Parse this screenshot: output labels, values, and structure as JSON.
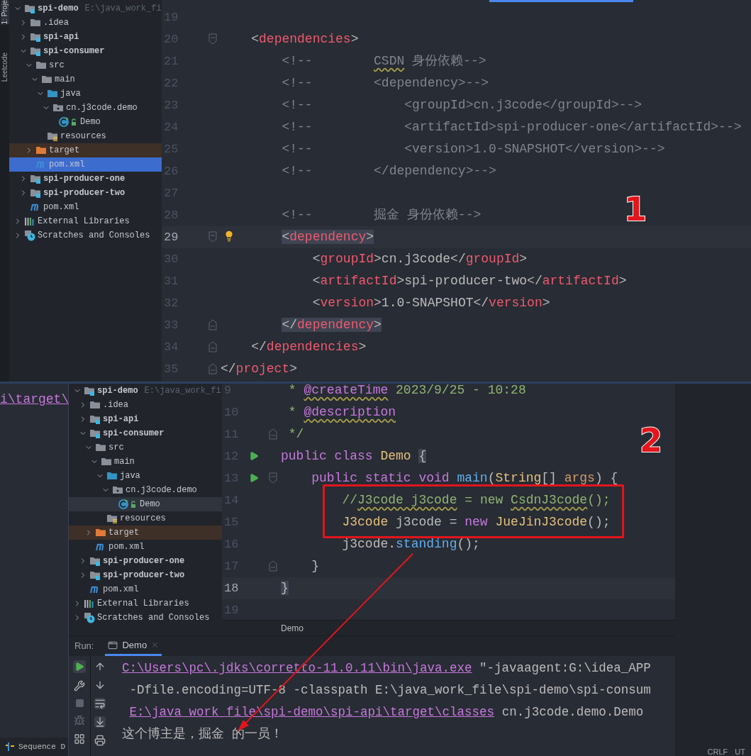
{
  "top": {
    "side_tabs": [
      "1: Proje",
      "Leetcode"
    ],
    "tree": {
      "focused": true,
      "items": [
        {
          "label": "spi-demo",
          "kind": "module",
          "path": "E:\\java_work_fi",
          "expanded": true,
          "selected": false,
          "children": [
            {
              "label": ".idea",
              "kind": "folder",
              "expanded": false,
              "selected": false
            },
            {
              "label": "spi-api",
              "kind": "module",
              "expanded": false,
              "selected": false
            },
            {
              "label": "spi-consumer",
              "kind": "module",
              "expanded": true,
              "selected": false,
              "children": [
                {
                  "label": "src",
                  "kind": "folder",
                  "expanded": true,
                  "selected": false,
                  "children": [
                    {
                      "label": "main",
                      "kind": "folder",
                      "expanded": true,
                      "selected": false,
                      "children": [
                        {
                          "label": "java",
                          "kind": "source",
                          "expanded": true,
                          "selected": false,
                          "children": [
                            {
                              "label": "cn.j3code.demo",
                              "kind": "package",
                              "expanded": true,
                              "selected": false,
                              "children": [
                                {
                                  "label": "Demo",
                                  "kind": "class",
                                  "selected": false
                                }
                              ]
                            }
                          ]
                        },
                        {
                          "label": "resources",
                          "kind": "resources",
                          "selected": false
                        }
                      ]
                    }
                  ]
                },
                {
                  "label": "target",
                  "kind": "excluded",
                  "expanded": false,
                  "selected": false
                },
                {
                  "label": "pom.xml",
                  "kind": "maven",
                  "selected": true
                }
              ]
            },
            {
              "label": "spi-producer-one",
              "kind": "module",
              "expanded": false,
              "selected": false
            },
            {
              "label": "spi-producer-two",
              "kind": "module",
              "expanded": false,
              "selected": false
            },
            {
              "label": "pom.xml",
              "kind": "maven",
              "selected": false
            }
          ]
        },
        {
          "label": "External Libraries",
          "kind": "libraries",
          "expanded": false,
          "selected": false
        },
        {
          "label": "Scratches and Consoles",
          "kind": "scratches",
          "expanded": false,
          "selected": false
        }
      ]
    },
    "editor": {
      "lines": [
        {
          "number": "19",
          "current": false
        },
        {
          "number": "20",
          "current": false,
          "fold_start": true,
          "tokens": [
            {
              "t": "    <",
              "kind": "punct"
            },
            {
              "t": "dependencies",
              "kind": "tag"
            },
            {
              "t": ">",
              "kind": "punct"
            }
          ]
        },
        {
          "number": "21",
          "current": false,
          "tokens": [
            {
              "t": "        <!--        ",
              "kind": "comment"
            },
            {
              "t": "CSDN",
              "kind": "comment",
              "typo": true
            },
            {
              "t": " 身份依赖-->",
              "kind": "comment"
            }
          ]
        },
        {
          "number": "22",
          "current": false,
          "tokens": [
            {
              "t": "        <!--        <dependency>-->",
              "kind": "comment"
            }
          ]
        },
        {
          "number": "23",
          "current": false,
          "tokens": [
            {
              "t": "        <!--            <groupId>cn.j3code</groupId>-->",
              "kind": "comment"
            }
          ]
        },
        {
          "number": "24",
          "current": false,
          "tokens": [
            {
              "t": "        <!--            <artifactId>spi-producer-one</artifactId>-->",
              "kind": "comment"
            }
          ]
        },
        {
          "number": "25",
          "current": false,
          "tokens": [
            {
              "t": "        <!--            <version>1.0-SNAPSHOT</version>-->",
              "kind": "comment"
            }
          ]
        },
        {
          "number": "26",
          "current": false,
          "tokens": [
            {
              "t": "        <!--        </dependency>-->",
              "kind": "comment"
            }
          ]
        },
        {
          "number": "27",
          "current": false
        },
        {
          "number": "28",
          "current": false,
          "tokens": [
            {
              "t": "        <!--        掘金 身份依赖-->",
              "kind": "comment"
            }
          ]
        },
        {
          "number": "29",
          "current": true,
          "fold_start": true,
          "bulb": true,
          "tokens": [
            {
              "t": "        <",
              "kind": "punct",
              "match": true
            },
            {
              "t": "dependency",
              "kind": "tag",
              "match": true
            },
            {
              "t": ">",
              "kind": "punct",
              "match": true
            }
          ]
        },
        {
          "number": "30",
          "current": false,
          "tokens": [
            {
              "t": "            <",
              "kind": "punct"
            },
            {
              "t": "groupId",
              "kind": "tag"
            },
            {
              "t": ">cn.j3code</",
              "kind": "punct"
            },
            {
              "t": "groupId",
              "kind": "tag"
            },
            {
              "t": ">",
              "kind": "punct"
            }
          ]
        },
        {
          "number": "31",
          "current": false,
          "tokens": [
            {
              "t": "            <",
              "kind": "punct"
            },
            {
              "t": "artifactId",
              "kind": "tag"
            },
            {
              "t": ">spi-producer-two</",
              "kind": "punct"
            },
            {
              "t": "artifactId",
              "kind": "tag"
            },
            {
              "t": ">",
              "kind": "punct"
            }
          ]
        },
        {
          "number": "32",
          "current": false,
          "tokens": [
            {
              "t": "            <",
              "kind": "punct"
            },
            {
              "t": "version",
              "kind": "tag"
            },
            {
              "t": ">1.0-SNAPSHOT</",
              "kind": "punct"
            },
            {
              "t": "version",
              "kind": "tag"
            },
            {
              "t": ">",
              "kind": "punct"
            }
          ]
        },
        {
          "number": "33",
          "current": false,
          "fold_end": true,
          "tokens": [
            {
              "t": "        </",
              "kind": "punct",
              "match": true
            },
            {
              "t": "dependency",
              "kind": "tag",
              "match": true
            },
            {
              "t": ">",
              "kind": "punct",
              "match": true
            }
          ]
        },
        {
          "number": "34",
          "current": false,
          "fold_end": true,
          "tokens": [
            {
              "t": "    </",
              "kind": "punct"
            },
            {
              "t": "dependencies",
              "kind": "tag"
            },
            {
              "t": ">",
              "kind": "punct"
            }
          ]
        },
        {
          "number": "35",
          "current": false,
          "fold_end": true,
          "tokens": [
            {
              "t": "</",
              "kind": "punct"
            },
            {
              "t": "project",
              "kind": "tag"
            },
            {
              "t": ">",
              "kind": "punct"
            }
          ]
        }
      ]
    },
    "annotations": [
      {
        "kind": "number",
        "text": "1"
      }
    ]
  },
  "bottom": {
    "left_link": "i\\target\\",
    "left_tool": "Sequence D",
    "tree": {
      "focused": false,
      "items": [
        {
          "label": "spi-demo",
          "kind": "module",
          "path": "E:\\java_work_fi",
          "expanded": true,
          "selected": false,
          "children": [
            {
              "label": ".idea",
              "kind": "folder",
              "expanded": false,
              "selected": false
            },
            {
              "label": "spi-api",
              "kind": "module",
              "expanded": false,
              "selected": false
            },
            {
              "label": "spi-consumer",
              "kind": "module",
              "expanded": true,
              "selected": false,
              "children": [
                {
                  "label": "src",
                  "kind": "folder",
                  "expanded": true,
                  "selected": false,
                  "children": [
                    {
                      "label": "main",
                      "kind": "folder",
                      "expanded": true,
                      "selected": false,
                      "children": [
                        {
                          "label": "java",
                          "kind": "source",
                          "expanded": true,
                          "selected": false,
                          "children": [
                            {
                              "label": "cn.j3code.demo",
                              "kind": "package",
                              "expanded": true,
                              "selected": false,
                              "children": [
                                {
                                  "label": "Demo",
                                  "kind": "class",
                                  "selected": true
                                }
                              ]
                            }
                          ]
                        },
                        {
                          "label": "resources",
                          "kind": "resources",
                          "selected": false
                        }
                      ]
                    }
                  ]
                },
                {
                  "label": "target",
                  "kind": "excluded",
                  "expanded": false,
                  "selected": false
                },
                {
                  "label": "pom.xml",
                  "kind": "maven",
                  "selected": false
                }
              ]
            },
            {
              "label": "spi-producer-one",
              "kind": "module",
              "expanded": false,
              "selected": false
            },
            {
              "label": "spi-producer-two",
              "kind": "module",
              "expanded": false,
              "selected": false
            },
            {
              "label": "pom.xml",
              "kind": "maven",
              "selected": false
            }
          ]
        },
        {
          "label": "External Libraries",
          "kind": "libraries",
          "expanded": false,
          "selected": false
        },
        {
          "label": "Scratches and Consoles",
          "kind": "scratches",
          "expanded": false,
          "selected": false
        }
      ]
    },
    "editor": {
      "lines": [
        {
          "number": "9",
          "current": false,
          "tokens": [
            {
              "t": " * ",
              "kind": "doc"
            },
            {
              "t": "@createTime",
              "kind": "doctag",
              "typo": true
            },
            {
              "t": " 2023/9/25 - 10:28",
              "kind": "doc"
            }
          ]
        },
        {
          "number": "10",
          "current": false,
          "tokens": [
            {
              "t": " * ",
              "kind": "doc"
            },
            {
              "t": "@description",
              "kind": "doctag",
              "typo": true
            }
          ]
        },
        {
          "number": "11",
          "current": false,
          "fold_end": true,
          "tokens": [
            {
              "t": " */",
              "kind": "doc"
            }
          ]
        },
        {
          "number": "12",
          "current": false,
          "run_marker": true,
          "tokens": [
            {
              "t": "public class ",
              "kind": "keyword"
            },
            {
              "t": "Demo",
              "kind": "class"
            },
            {
              "t": " {",
              "kind": "punct",
              "match": true
            }
          ]
        },
        {
          "number": "13",
          "current": false,
          "run_marker": true,
          "fold_start": true,
          "tokens": [
            {
              "t": "    public static void ",
              "kind": "keyword"
            },
            {
              "t": "main",
              "kind": "method"
            },
            {
              "t": "(",
              "kind": "punct"
            },
            {
              "t": "String",
              "kind": "class"
            },
            {
              "t": "[] ",
              "kind": "punct"
            },
            {
              "t": "args",
              "kind": "param"
            },
            {
              "t": ") {",
              "kind": "punct"
            }
          ]
        },
        {
          "number": "14",
          "current": false,
          "tokens": [
            {
              "t": "        //",
              "kind": "linecomment"
            },
            {
              "t": "J3code j3code",
              "kind": "linecomment",
              "typo": true
            },
            {
              "t": " = new ",
              "kind": "linecomment"
            },
            {
              "t": "CsdnJ3code",
              "kind": "linecomment",
              "typo": true
            },
            {
              "t": "();",
              "kind": "linecomment"
            }
          ]
        },
        {
          "number": "15",
          "current": false,
          "tokens": [
            {
              "t": "        J3code",
              "kind": "class"
            },
            {
              "t": " j3code = ",
              "kind": "punct"
            },
            {
              "t": "new",
              "kind": "keyword"
            },
            {
              "t": " JueJinJ3code",
              "kind": "class"
            },
            {
              "t": "();",
              "kind": "punct"
            }
          ]
        },
        {
          "number": "16",
          "current": false,
          "tokens": [
            {
              "t": "        j3code.",
              "kind": "punct"
            },
            {
              "t": "standing",
              "kind": "method"
            },
            {
              "t": "();",
              "kind": "punct"
            }
          ]
        },
        {
          "number": "17",
          "current": false,
          "fold_end": true,
          "tokens": [
            {
              "t": "    }",
              "kind": "punct"
            }
          ]
        },
        {
          "number": "18",
          "current": true,
          "tokens": [
            {
              "t": "}",
              "kind": "punct",
              "match": true
            }
          ]
        },
        {
          "number": "19",
          "current": false
        }
      ],
      "breadcrumb": "Demo"
    },
    "run": {
      "title": "Run:",
      "tab": "Demo",
      "lines": [
        {
          "segments": [
            {
              "t": "C:\\Users\\pc\\.jdks\\corretto-11.0.11\\bin\\java.exe",
              "link": true
            },
            {
              "t": " \"-javaagent:G:\\idea_APP",
              "link": false
            }
          ]
        },
        {
          "segments": [
            {
              "t": " -Dfile.encoding=UTF-8 -classpath E:\\java_work_file\\spi-demo\\spi-consum",
              "link": false
            }
          ]
        },
        {
          "segments": [
            {
              "t": " E:\\java_work_file\\spi-demo\\spi-api\\target\\classes",
              "link": true
            },
            {
              "t": " cn.j3code.demo.Demo",
              "link": false
            }
          ]
        },
        {
          "segments": [
            {
              "t": "这个博主是，掘金 的一员！",
              "link": false
            }
          ]
        }
      ]
    },
    "status": [
      "CRLF",
      "UT"
    ],
    "annotations": [
      {
        "kind": "number",
        "text": "2"
      },
      {
        "kind": "box"
      },
      {
        "kind": "arrow"
      }
    ]
  }
}
